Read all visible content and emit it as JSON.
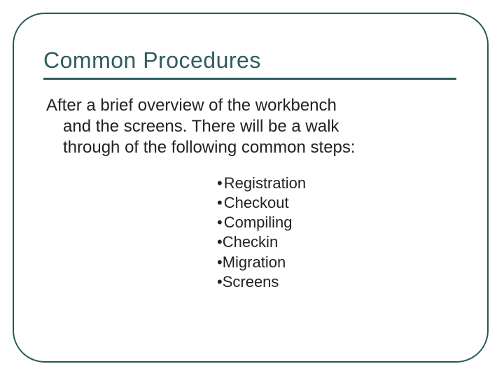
{
  "title": "Common Procedures",
  "body_line1": "After a brief overview of the workbench",
  "body_line2": "and the screens.  There will be a walk",
  "body_line3": "through of the following common steps:",
  "bullets": {
    "b0": "Registration",
    "b1": "Checkout",
    "b2": "Compiling",
    "b3": "Checkin",
    "b4": "Migration",
    "b5": "Screens"
  }
}
